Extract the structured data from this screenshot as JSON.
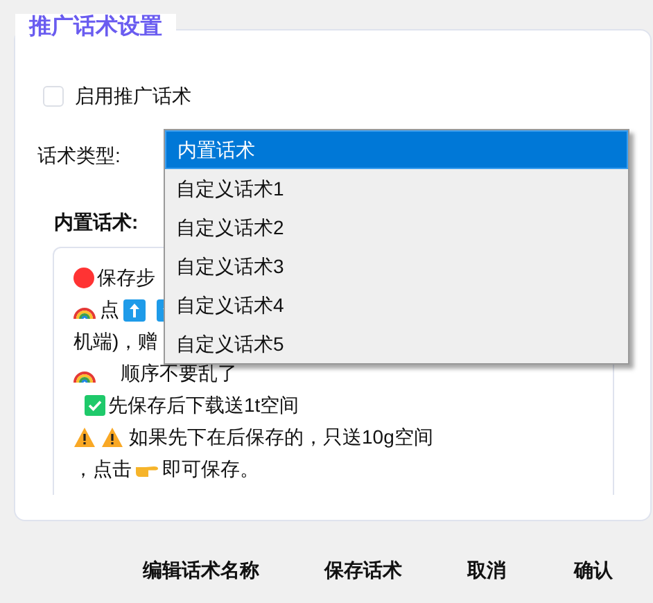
{
  "panel": {
    "title": "推广话术设置"
  },
  "enable": {
    "label": "启用推广话术",
    "checked": false
  },
  "type_select": {
    "label": "话术类型:",
    "options": [
      {
        "label": "内置话术",
        "selected": true
      },
      {
        "label": "自定义话术1",
        "selected": false
      },
      {
        "label": "自定义话术2",
        "selected": false
      },
      {
        "label": "自定义话术3",
        "selected": false
      },
      {
        "label": "自定义话术4",
        "selected": false
      },
      {
        "label": "自定义话术5",
        "selected": false
      }
    ]
  },
  "script": {
    "label": "内置话术:",
    "lines": [
      {
        "kind": "dot",
        "text": "保存步"
      },
      {
        "kind": "arrows",
        "text": "点"
      },
      {
        "kind": "plain",
        "text": "机端)，赠"
      },
      {
        "kind": "rainbow",
        "text": "顺序不要乱了"
      },
      {
        "kind": "check",
        "text": "先保存后下载送1t空间"
      },
      {
        "kind": "warning",
        "text": "如果先下在后保存的，只送10g空间"
      },
      {
        "kind": "hand",
        "text": "，点击",
        "text_after": "即可保存。"
      }
    ]
  },
  "buttons": [
    "编辑话术名称",
    "保存话术",
    "取消",
    "确认"
  ]
}
